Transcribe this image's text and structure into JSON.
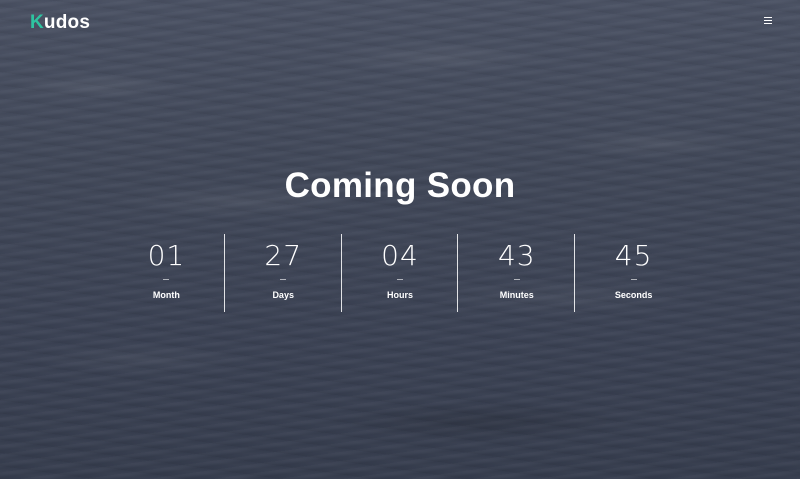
{
  "header": {
    "logo_first_letter": "K",
    "logo_rest": "udos",
    "logo_accent_color": "#2ec4a0",
    "menu_icon": "hamburger-menu-icon"
  },
  "hero": {
    "title": "Coming Soon"
  },
  "countdown": [
    {
      "value": "01",
      "label": "Month"
    },
    {
      "value": "27",
      "label": "Days"
    },
    {
      "value": "04",
      "label": "Hours"
    },
    {
      "value": "43",
      "label": "Minutes"
    },
    {
      "value": "45",
      "label": "Seconds"
    }
  ]
}
